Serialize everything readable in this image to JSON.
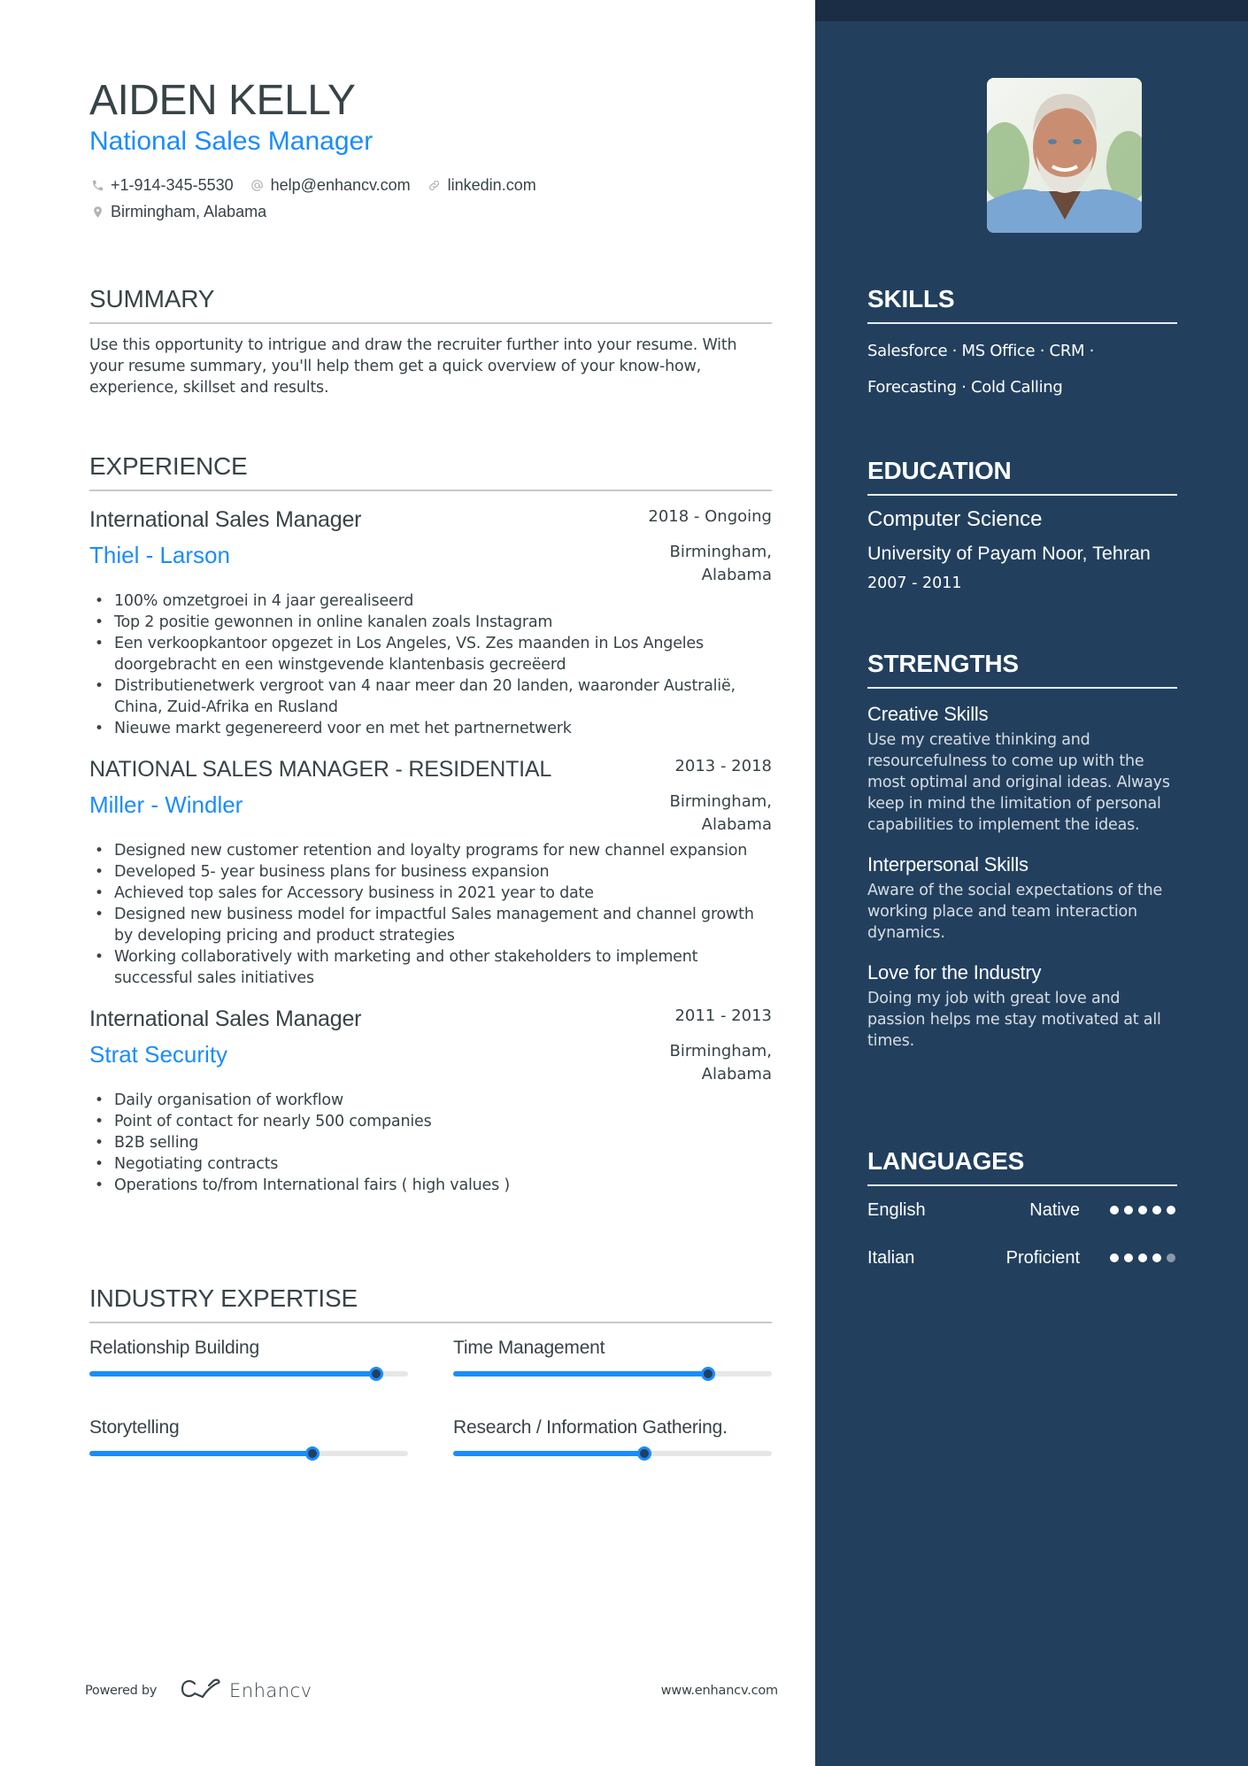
{
  "header": {
    "name": "AIDEN KELLY",
    "title": "National Sales Manager",
    "contacts": {
      "phone": {
        "icon": "phone-icon",
        "text": "+1-914-345-5530"
      },
      "email": {
        "icon": "at-icon",
        "text": "help@enhancv.com"
      },
      "link": {
        "icon": "link-icon",
        "text": "linkedin.com"
      },
      "location": {
        "icon": "location-pin-icon",
        "text": "Birmingham, Alabama"
      }
    }
  },
  "summary": {
    "heading": "SUMMARY",
    "text": "Use this opportunity to intrigue and draw the recruiter further into your resume. With your resume summary, you'll help them get a quick overview of your know-how, experience, skillset and results."
  },
  "experience": {
    "heading": "EXPERIENCE",
    "jobs": [
      {
        "role": "International Sales Manager",
        "dates": "2018 - Ongoing",
        "company": "Thiel - Larson",
        "location": "Birmingham, Alabama",
        "bullets": [
          "100% omzetgroei in 4 jaar gerealiseerd",
          "Top 2 positie gewonnen in online kanalen zoals Instagram",
          "Een verkoopkantoor opgezet in Los Angeles, VS. Zes maanden in Los Angeles doorgebracht en een winstgevende klantenbasis gecreëerd",
          "Distributienetwerk vergroot van 4 naar meer dan 20 landen, waaronder Australië, China, Zuid-Afrika en Rusland",
          "Nieuwe markt gegenereerd voor en met het partnernetwerk"
        ]
      },
      {
        "role": "NATIONAL SALES MANAGER - RESIDENTIAL",
        "dates": "2013 - 2018",
        "company": "Miller - Windler",
        "location": "Birmingham, Alabama",
        "bullets": [
          "Designed new customer retention and loyalty programs for new channel expansion",
          "Developed 5- year business plans for business expansion",
          "Achieved top sales for Accessory business in 2021 year to date",
          "Designed new business model for impactful Sales management and channel growth by developing pricing and product strategies",
          "Working collaboratively with marketing and other stakeholders to implement successful sales initiatives"
        ]
      },
      {
        "role": "International Sales Manager",
        "dates": "2011 - 2013",
        "company": "Strat Security",
        "location": "Birmingham, Alabama",
        "bullets": [
          "Daily organisation of workflow",
          "Point of contact for nearly 500 companies",
          "B2B selling",
          "Negotiating contracts",
          "Operations to/from International fairs ( high values )"
        ]
      }
    ]
  },
  "expertise": {
    "heading": "INDUSTRY EXPERTISE",
    "items": [
      {
        "label": "Relationship Building",
        "level": 0.9
      },
      {
        "label": "Time Management",
        "level": 0.8
      },
      {
        "label": "Storytelling",
        "level": 0.7
      },
      {
        "label": "Research / Information Gathering.",
        "level": 0.6
      }
    ]
  },
  "footer": {
    "powered_by": "Powered by",
    "brand": "Enhancv",
    "brand_icon": "enhancv-logo-icon",
    "website": "www.enhancv.com"
  },
  "sidebar": {
    "photo_alt": "Profile photo of a smiling man with grey hair and beard wearing a blue denim shirt",
    "skills": {
      "heading": "SKILLS",
      "text": "Salesforce · MS Office · CRM · Forecasting · Cold Calling"
    },
    "education": {
      "heading": "EDUCATION",
      "degree": "Computer Science",
      "school": "University of Payam Noor, Tehran",
      "years": "2007 - 2011"
    },
    "strengths": {
      "heading": "STRENGTHS",
      "items": [
        {
          "title": "Creative Skills",
          "description": "Use my creative thinking and resourcefulness to come up with the most optimal and original ideas. Always keep in mind the limitation of personal capabilities to implement the ideas."
        },
        {
          "title": "Interpersonal Skills",
          "description": "Aware of the social expectations of the working place and team interaction dynamics."
        },
        {
          "title": "Love for the Industry",
          "description": "Doing my job with great love and passion helps me stay motivated at all times."
        }
      ]
    },
    "languages": {
      "heading": "LANGUAGES",
      "items": [
        {
          "name": "English",
          "level": "Native",
          "rating": 5,
          "max": 5
        },
        {
          "name": "Italian",
          "level": "Proficient",
          "rating": 4,
          "max": 5
        }
      ]
    }
  },
  "colors": {
    "accent": "#1a8cff",
    "text": "#384347",
    "sidebar": "#22405e",
    "sidebar_top": "#1a2d45"
  }
}
